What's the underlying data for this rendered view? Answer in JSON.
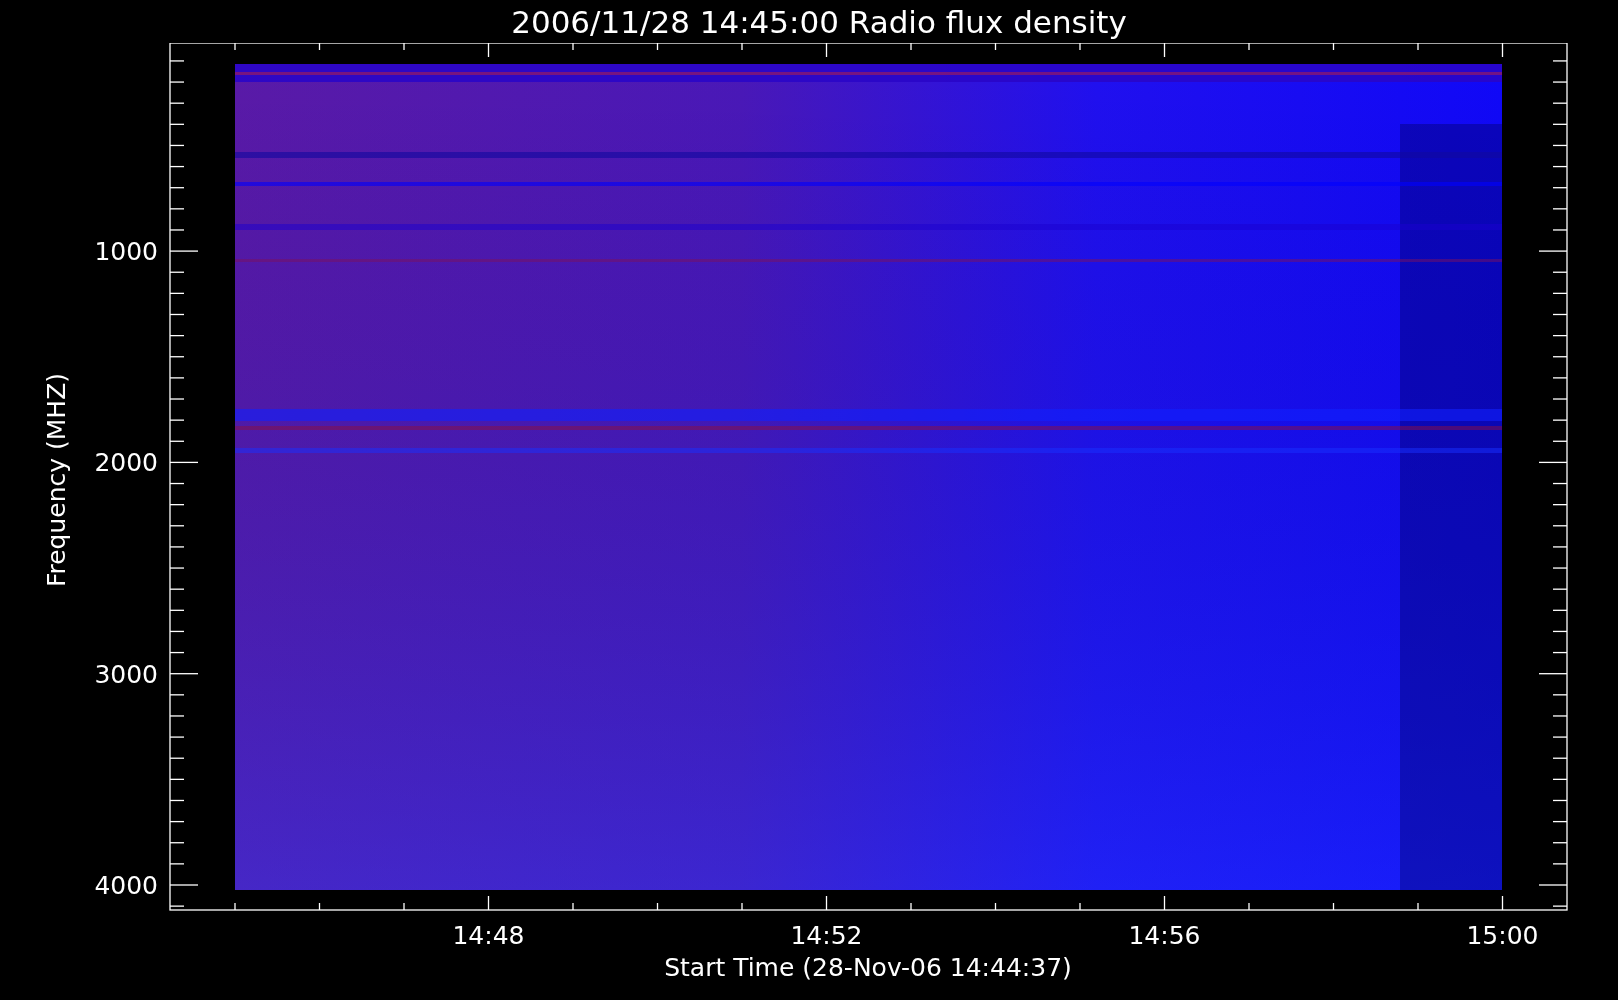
{
  "title": "2006/11/28 14:45:00 Radio flux density",
  "chart": {
    "ylabel": "Frequency (MHZ)",
    "xlabel": "Start Time (28-Nov-06 14:44:37)",
    "yticks": [
      "1000",
      "2000",
      "3000",
      "4000"
    ],
    "xticks": [
      "14:48",
      "14:52",
      "14:56",
      "15:00"
    ]
  }
}
